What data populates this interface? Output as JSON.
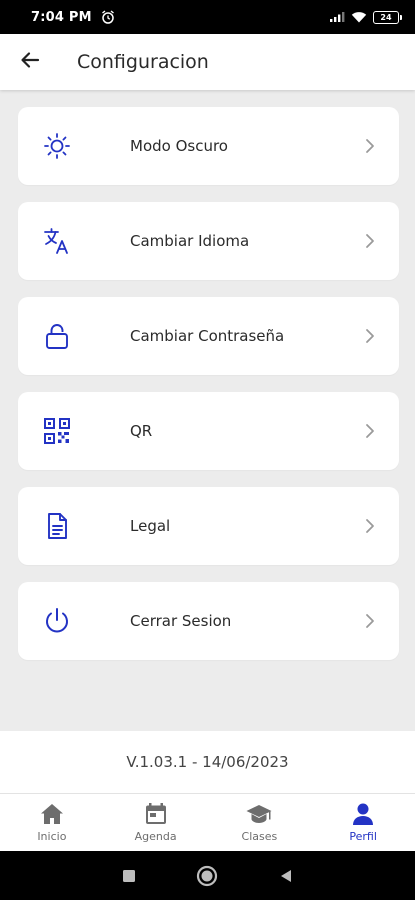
{
  "status_bar": {
    "time": "7:04 PM",
    "battery": "24"
  },
  "header": {
    "title": "Configuracion"
  },
  "settings": [
    {
      "id": "dark-mode",
      "label": "Modo Oscuro",
      "icon": "sun-icon"
    },
    {
      "id": "language",
      "label": "Cambiar Idioma",
      "icon": "translate-icon"
    },
    {
      "id": "password",
      "label": "Cambiar Contraseña",
      "icon": "lock-icon"
    },
    {
      "id": "qr",
      "label": "QR",
      "icon": "qr-code-icon"
    },
    {
      "id": "legal",
      "label": "Legal",
      "icon": "document-icon"
    },
    {
      "id": "logout",
      "label": "Cerrar Sesion",
      "icon": "power-icon"
    }
  ],
  "version": {
    "text": "V.1.03.1 - 14/06/2023"
  },
  "bottom_nav": [
    {
      "label": "Inicio",
      "icon": "home-icon",
      "active": false
    },
    {
      "label": "Agenda",
      "icon": "calendar-icon",
      "active": false
    },
    {
      "label": "Clases",
      "icon": "graduation-cap-icon",
      "active": false
    },
    {
      "label": "Perfil",
      "icon": "person-icon",
      "active": true
    }
  ],
  "colors": {
    "accent": "#2333c4",
    "inactive": "#6d6d6d",
    "background": "#ececec"
  }
}
